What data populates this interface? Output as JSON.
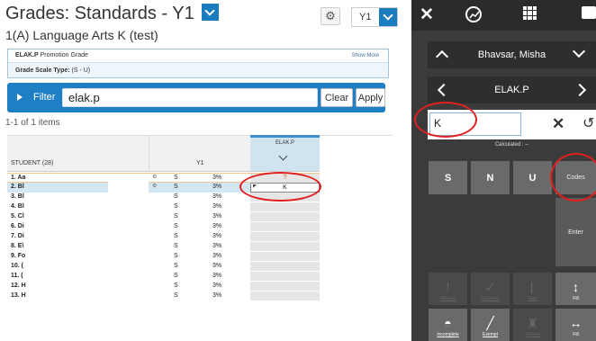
{
  "header": {
    "title": "Grades: Standards - Y1",
    "subtitle": "1(A) Language Arts K (test)",
    "term_select": "Y1"
  },
  "info": {
    "standard_code": "ELAK.P",
    "standard_name": "Promotion Grade",
    "show_more": "Show More",
    "grade_scale_label": "Grade Scale Type:",
    "grade_scale_value": "(S - U)"
  },
  "filter": {
    "label": "Filter",
    "value": "elak.p",
    "clear_label": "Clear",
    "apply_label": "Apply"
  },
  "items_count": "1-1 of 1 items",
  "table": {
    "student_header": "STUDENT (28)",
    "term_header": "Y1",
    "standard_header": "ELAK.P",
    "rows": [
      {
        "name": "1. Aa",
        "grade": "S",
        "pct": "3%",
        "score": "?"
      },
      {
        "name": "2. Bl",
        "grade": "S",
        "pct": "3%",
        "score": "K"
      },
      {
        "name": "3. Bl",
        "grade": "S",
        "pct": "3%",
        "score": ""
      },
      {
        "name": "4. Bl",
        "grade": "S",
        "pct": "3%",
        "score": ""
      },
      {
        "name": "5. Cl",
        "grade": "S",
        "pct": "3%",
        "score": ""
      },
      {
        "name": "6. Di",
        "grade": "S",
        "pct": "3%",
        "score": ""
      },
      {
        "name": "7. Di",
        "grade": "S",
        "pct": "3%",
        "score": ""
      },
      {
        "name": "8. E\\",
        "grade": "S",
        "pct": "3%",
        "score": ""
      },
      {
        "name": "9. Fo",
        "grade": "S",
        "pct": "3%",
        "score": ""
      },
      {
        "name": "10. (",
        "grade": "S",
        "pct": "3%",
        "score": ""
      },
      {
        "name": "11. (",
        "grade": "S",
        "pct": "3%",
        "score": ""
      },
      {
        "name": "12. H",
        "grade": "S",
        "pct": "3%",
        "score": ""
      },
      {
        "name": "13. H",
        "grade": "S",
        "pct": "3%",
        "score": ""
      }
    ]
  },
  "panel": {
    "student_name": "Bhavsar, Misha",
    "standard": "ELAK.P",
    "score_value": "K",
    "calculated": "Calculated : --",
    "keys": {
      "s": "S",
      "n": "N",
      "u": "U",
      "codes": "Codes",
      "enter": "Enter"
    },
    "bottom": {
      "missing": "Missing",
      "collected": "Collected",
      "late": "Late",
      "fill1": "Fill",
      "incomplete": "Incomplete",
      "exempt": "Exempt",
      "absent": "Absent",
      "fill2": "Fill"
    }
  },
  "colors": {
    "accent": "#1f7fc4",
    "annotation": "#e02020",
    "panel_bg": "#3b3b3b"
  }
}
